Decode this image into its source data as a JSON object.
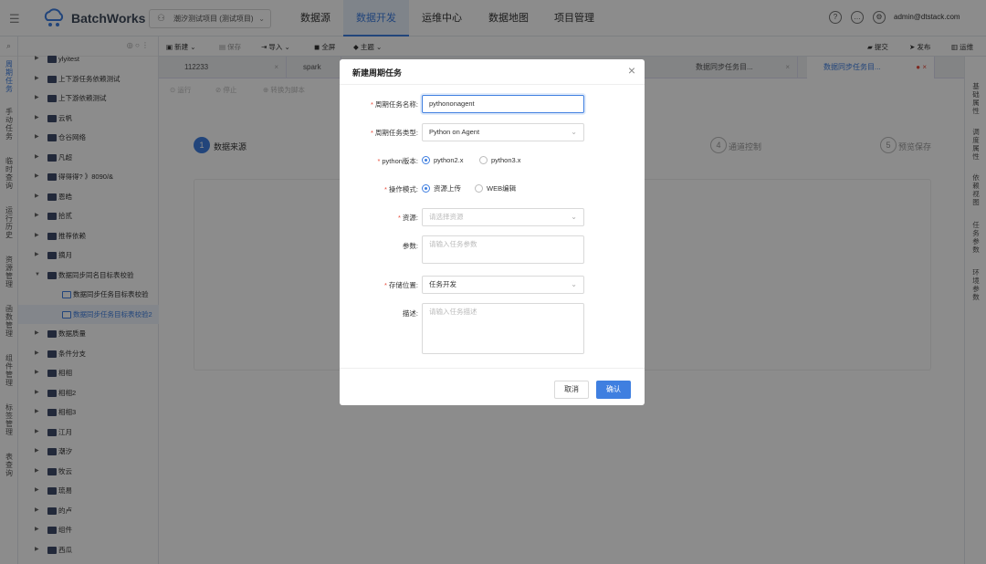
{
  "app": {
    "name": "BatchWorks",
    "project": "潮汐测试项目 (测试项目)",
    "user": "admin@dtstack.com"
  },
  "nav": [
    "数据源",
    "数据开发",
    "运维中心",
    "数据地图",
    "项目管理"
  ],
  "left_rail": [
    "周期任务",
    "手动任务",
    "临时查询",
    "运行历史",
    "资源管理",
    "函数管理",
    "组件管理",
    "标签管理",
    "表查询"
  ],
  "tree": [
    {
      "label": "ylyitest"
    },
    {
      "label": "上下游任务依赖测试"
    },
    {
      "label": "上下游依赖测试"
    },
    {
      "label": "云帆"
    },
    {
      "label": "仓谷网络"
    },
    {
      "label": "凡超"
    },
    {
      "label": "得得得? 》8090/&"
    },
    {
      "label": "恩皓"
    },
    {
      "label": "拾贰"
    },
    {
      "label": "推荐依赖"
    },
    {
      "label": "摘月"
    },
    {
      "label": "数据同步同名目标表校验"
    },
    {
      "label": "数据同步任务目标表校验"
    },
    {
      "label": "数据同步任务目标表校验2"
    },
    {
      "label": "数据质量"
    },
    {
      "label": "条件分支"
    },
    {
      "label": "相相"
    },
    {
      "label": "相相2"
    },
    {
      "label": "相相3"
    },
    {
      "label": "江月"
    },
    {
      "label": "潮汐"
    },
    {
      "label": "牧云"
    },
    {
      "label": "琉易"
    },
    {
      "label": "的卢"
    },
    {
      "label": "组件"
    },
    {
      "label": "西瓜"
    }
  ],
  "toolbar": {
    "new": "新建",
    "save": "保存",
    "import": "导入",
    "fullscreen": "全屏",
    "theme": "主题",
    "submit": "提交",
    "publish": "发布",
    "ops": "运维"
  },
  "tabs": [
    "112233",
    "spark",
    "数据同步任务目...",
    "数据同步任务目..."
  ],
  "sub_toolbar": {
    "run": "运行",
    "stop": "停止",
    "convert": "转换为脚本"
  },
  "steps": [
    {
      "num": "1",
      "label": "数据来源"
    },
    {
      "num": "4",
      "label": "通道控制"
    },
    {
      "num": "5",
      "label": "预览保存"
    }
  ],
  "right_rail": [
    "基础属性",
    "调度属性",
    "依赖视图",
    "任务参数",
    "环境参数"
  ],
  "modal": {
    "title": "新建周期任务",
    "fields": {
      "name_label": "周期任务名称:",
      "name_value": "pythononagent",
      "type_label": "周期任务类型:",
      "type_value": "Python on Agent",
      "python_label": "python版本:",
      "python_opt1": "python2.x",
      "python_opt2": "python3.x",
      "mode_label": "操作模式:",
      "mode_opt1": "资源上传",
      "mode_opt2": "WEB编辑",
      "resource_label": "资源:",
      "resource_placeholder": "请选择资源",
      "params_label": "参数:",
      "params_placeholder": "请输入任务参数",
      "storage_label": "存储位置:",
      "storage_value": "任务开发",
      "desc_label": "描述:",
      "desc_placeholder": "请输入任务描述"
    },
    "cancel": "取消",
    "ok": "确认"
  },
  "colors": {
    "primary": "#3f7fe0",
    "required": "#e74c3c",
    "overlay": "rgba(0,0,0,0.45)"
  }
}
